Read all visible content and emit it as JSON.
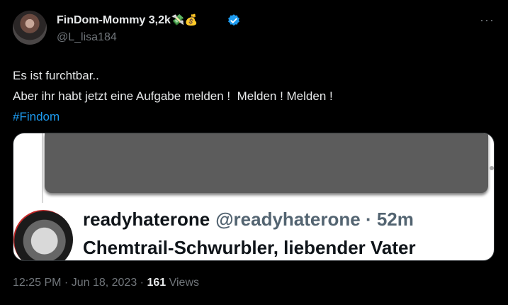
{
  "author": {
    "display_name": "FinDom-Mommy 3,2k",
    "name_emojis": "💸💰",
    "handle": "@L_lisa184",
    "verified_color": "#1d9bf0"
  },
  "more_label": "···",
  "tweet": {
    "lines": [
      "Es ist furchtbar..",
      "Aber ihr habt jetzt eine Aufgabe melden !  Melden ! Melden !"
    ],
    "hashtag": "#Findom",
    "hashtag_color": "#1d9bf0"
  },
  "media": {
    "quoted_name": "readyhaterone",
    "quoted_handle": "@readyhaterone · 52m",
    "quoted_bio": "Chemtrail-Schwurbler, liebender Vater"
  },
  "meta": {
    "time": "12:25 PM",
    "date": "Jun 18, 2023",
    "views_count": "161",
    "views_label": "Views"
  }
}
